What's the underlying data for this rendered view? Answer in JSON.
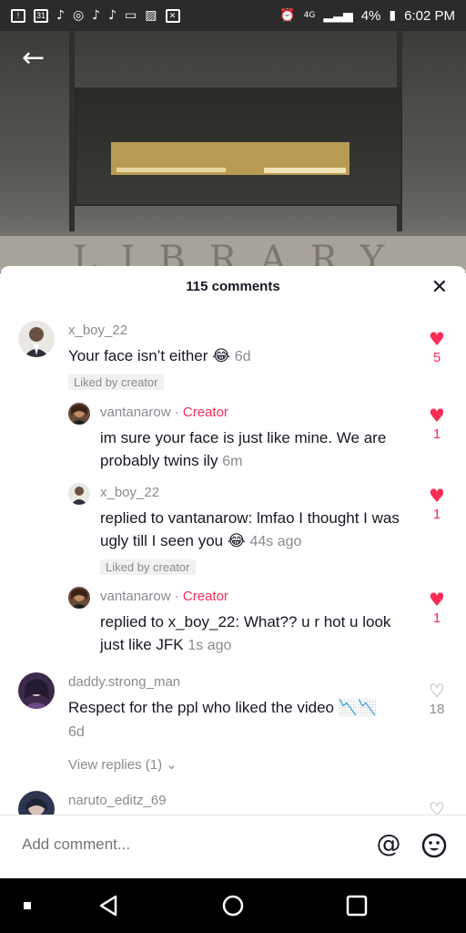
{
  "status_bar": {
    "battery_percent": "4%",
    "time": "6:02 PM",
    "left_icons": [
      "alert-icon",
      "calendar-icon",
      "tiktok-icon",
      "instagram-icon",
      "tiktok-icon",
      "tiktok-icon",
      "voicemail-icon",
      "image-icon",
      "close-box-icon"
    ],
    "calendar_label": "31",
    "network_label": "4G"
  },
  "sheet": {
    "title": "115 comments"
  },
  "comments": [
    {
      "username": "x_boy_22",
      "text": "Your face isn’t either",
      "emoji": "😂",
      "timestamp": "6d",
      "badge": "Liked by creator",
      "likes": "5",
      "liked": true
    },
    {
      "username": "vantanarow",
      "separator": "·",
      "creator_label": "Creator",
      "text": "im sure your face is just like mine. We are probably twins ily",
      "timestamp": "6m",
      "likes": "1",
      "liked": true
    },
    {
      "username": "x_boy_22",
      "text": "replied to vantanarow: lmfao I thought I was ugly till I seen you",
      "emoji": "😂",
      "timestamp": "44s ago",
      "badge": "Liked by creator",
      "likes": "1",
      "liked": true
    },
    {
      "username": "vantanarow",
      "separator": "·",
      "creator_label": "Creator",
      "text": "replied to x_boy_22: What?? u r hot u look just like JFK",
      "timestamp": "1s ago",
      "likes": "1",
      "liked": true
    },
    {
      "username": "daddy.strong_man",
      "text": "Respect for the ppl who liked the video",
      "emoji": "📉📉",
      "timestamp": "6d",
      "likes": "18",
      "liked": false,
      "view_replies": "View replies (1)"
    },
    {
      "username": "naruto_editz_69",
      "liked": false
    }
  ],
  "add_comment": {
    "placeholder": "Add comment..."
  },
  "colors": {
    "accent": "#fe2c55",
    "text_primary": "#161823",
    "text_secondary": "#8a8b91"
  }
}
